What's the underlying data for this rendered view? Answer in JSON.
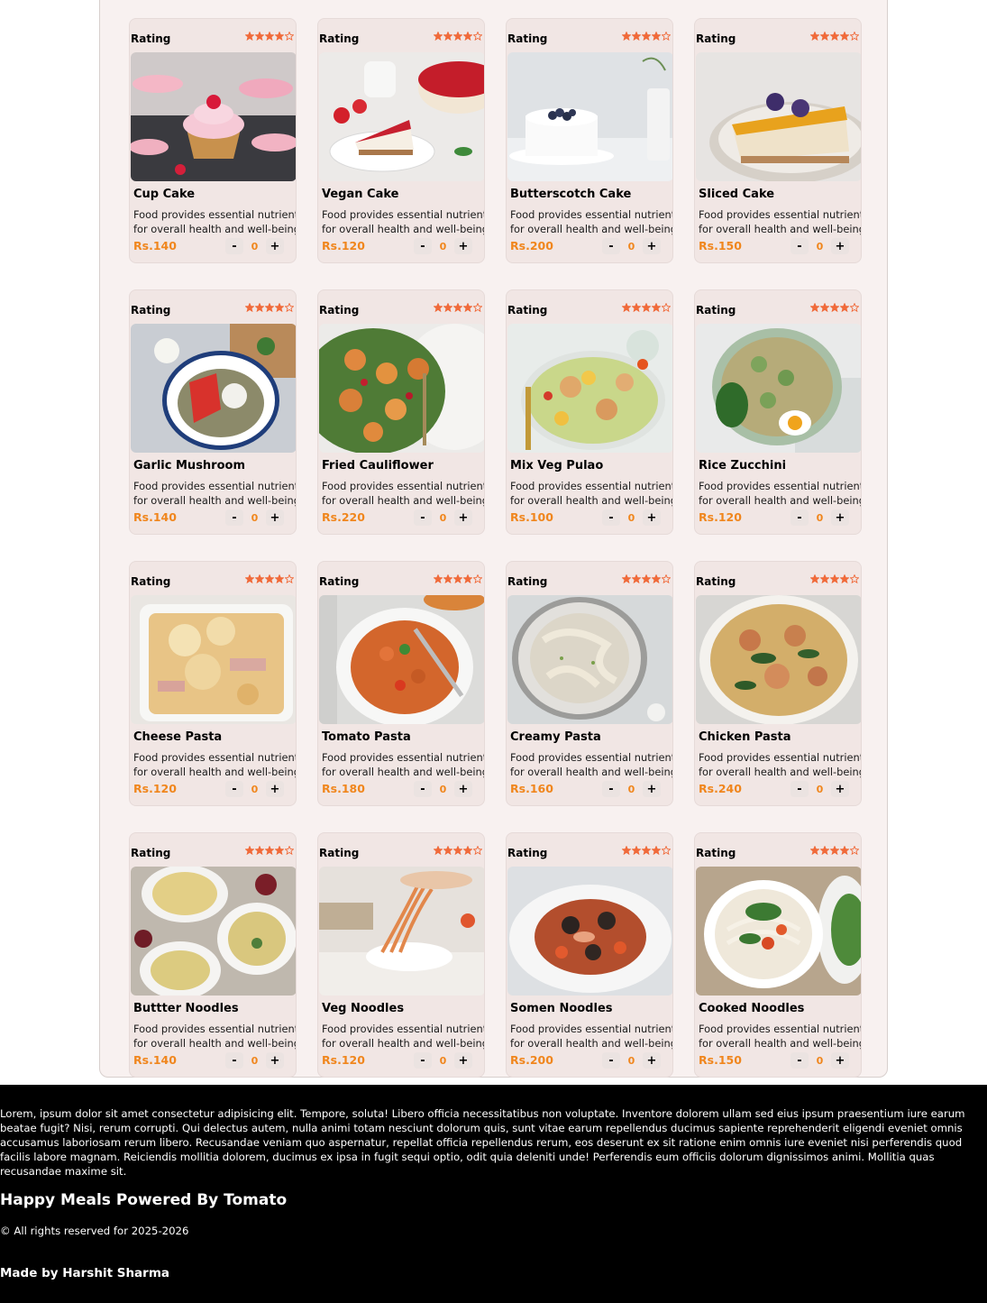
{
  "colors": {
    "panel_bg": "#f8f1f0",
    "card_bg": "#f1e6e4",
    "price": "#f0861d",
    "star": "#f06a3a",
    "footer_bg": "#000000"
  },
  "menu": {
    "rating_label": "Rating",
    "rating_value": 4,
    "rating_max": 5,
    "description": "Food provides essential nutrients for overall health and well-being",
    "description_line1": "Food provides essential nutrients",
    "description_line2": "for overall health and well-being",
    "minus_label": "-",
    "plus_label": "+",
    "items": [
      {
        "name": "Cup Cake",
        "price": "Rs.140",
        "qty": "0",
        "image": "cupcake-photo"
      },
      {
        "name": "Vegan Cake",
        "price": "Rs.120",
        "qty": "0",
        "image": "strawberry-cheesecake-photo"
      },
      {
        "name": "Butterscotch Cake",
        "price": "Rs.200",
        "qty": "0",
        "image": "white-cake-blueberries-photo"
      },
      {
        "name": "Sliced Cake",
        "price": "Rs.150",
        "qty": "0",
        "image": "cheesecake-slice-photo"
      },
      {
        "name": "Garlic Mushroom",
        "price": "Rs.140",
        "qty": "0",
        "image": "plate-salad-photo"
      },
      {
        "name": "Fried Cauliflower",
        "price": "Rs.220",
        "qty": "0",
        "image": "roasted-cauliflower-salad-photo"
      },
      {
        "name": "Mix Veg Pulao",
        "price": "Rs.100",
        "qty": "0",
        "image": "caesar-salad-photo"
      },
      {
        "name": "Rice Zucchini",
        "price": "Rs.120",
        "qty": "0",
        "image": "zucchini-rice-egg-photo"
      },
      {
        "name": "Cheese Pasta",
        "price": "Rs.120",
        "qty": "0",
        "image": "cheese-pasta-bake-photo"
      },
      {
        "name": "Tomato Pasta",
        "price": "Rs.180",
        "qty": "0",
        "image": "tomato-fusilli-photo"
      },
      {
        "name": "Creamy Pasta",
        "price": "Rs.160",
        "qty": "0",
        "image": "creamy-fettuccine-photo"
      },
      {
        "name": "Chicken Pasta",
        "price": "Rs.240",
        "qty": "0",
        "image": "chicken-pasta-photo"
      },
      {
        "name": "Buttter Noodles",
        "price": "Rs.140",
        "qty": "0",
        "image": "butter-noodles-table-photo"
      },
      {
        "name": "Veg Noodles",
        "price": "Rs.120",
        "qty": "0",
        "image": "noodles-lifted-bowl-photo"
      },
      {
        "name": "Somen Noodles",
        "price": "Rs.200",
        "qty": "0",
        "image": "seafood-spaghetti-photo"
      },
      {
        "name": "Cooked Noodles",
        "price": "Rs.150",
        "qty": "0",
        "image": "noodle-soup-herbs-photo"
      }
    ]
  },
  "footer": {
    "text": "Lorem, ipsum dolor sit amet consectetur adipisicing elit. Tempore, soluta! Libero officia necessitatibus non voluptate. Inventore dolorem ullam sed eius ipsum praesentium iure earum beatae fugit? Nisi, rerum corrupti. Qui delectus autem, nulla animi totam nesciunt dolorum quis, sunt vitae earum repellendus ducimus sapiente reprehenderit eligendi eveniet omnis accusamus laboriosam rerum libero. Recusandae veniam quo aspernatur, repellat officia repellendus rerum, eos deserunt ex sit ratione enim omnis iure eveniet nisi perferendis quod facilis labore magnam. Reiciendis mollitia dolorem, ducimus ex ipsa in fugit sequi optio, odit quia deleniti unde! Perferendis eum officiis dolorum dignissimos animi. Mollitia quas recusandae maxime sit.",
    "brand": "Happy Meals Powered By Tomato",
    "rights": "© All rights reserved for 2025-2026",
    "made_by": "Made by Harshit Sharma"
  }
}
